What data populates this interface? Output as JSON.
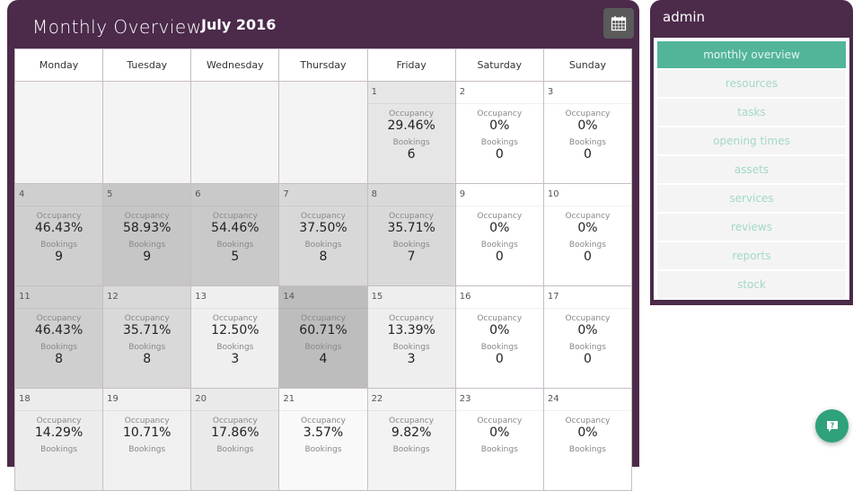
{
  "header": {
    "title": "Monthly Overview",
    "month": "July 2016",
    "calendar_icon": "calendar-icon"
  },
  "calendar": {
    "weekdays": [
      "Monday",
      "Tuesday",
      "Wednesday",
      "Thursday",
      "Friday",
      "Saturday",
      "Sunday"
    ],
    "occupancy_label": "Occupancy",
    "bookings_label": "Bookings",
    "weeks": [
      [
        null,
        null,
        null,
        null,
        {
          "day": "1",
          "occupancy": "29.46%",
          "bookings": "6",
          "bg": "#e6e6e6"
        },
        {
          "day": "2",
          "occupancy": "0%",
          "bookings": "0",
          "bg": "#ffffff"
        },
        {
          "day": "3",
          "occupancy": "0%",
          "bookings": "0",
          "bg": "#ffffff"
        }
      ],
      [
        {
          "day": "4",
          "occupancy": "46.43%",
          "bookings": "9",
          "bg": "#cfcfcf"
        },
        {
          "day": "5",
          "occupancy": "58.93%",
          "bookings": "9",
          "bg": "#c6c6c6"
        },
        {
          "day": "6",
          "occupancy": "54.46%",
          "bookings": "5",
          "bg": "#c9c9c9"
        },
        {
          "day": "7",
          "occupancy": "37.50%",
          "bookings": "8",
          "bg": "#d8d8d8"
        },
        {
          "day": "8",
          "occupancy": "35.71%",
          "bookings": "7",
          "bg": "#d9d9d9"
        },
        {
          "day": "9",
          "occupancy": "0%",
          "bookings": "0",
          "bg": "#ffffff"
        },
        {
          "day": "10",
          "occupancy": "0%",
          "bookings": "0",
          "bg": "#ffffff"
        }
      ],
      [
        {
          "day": "11",
          "occupancy": "46.43%",
          "bookings": "8",
          "bg": "#cfcfcf"
        },
        {
          "day": "12",
          "occupancy": "35.71%",
          "bookings": "8",
          "bg": "#d9d9d9"
        },
        {
          "day": "13",
          "occupancy": "12.50%",
          "bookings": "3",
          "bg": "#efefef"
        },
        {
          "day": "14",
          "occupancy": "60.71%",
          "bookings": "4",
          "bg": "#bdbdbd"
        },
        {
          "day": "15",
          "occupancy": "13.39%",
          "bookings": "3",
          "bg": "#eeeeee"
        },
        {
          "day": "16",
          "occupancy": "0%",
          "bookings": "0",
          "bg": "#ffffff"
        },
        {
          "day": "17",
          "occupancy": "0%",
          "bookings": "0",
          "bg": "#ffffff"
        }
      ],
      [
        {
          "day": "18",
          "occupancy": "14.29%",
          "bookings": "",
          "bg": "#ececec"
        },
        {
          "day": "19",
          "occupancy": "10.71%",
          "bookings": "",
          "bg": "#f0f0f0"
        },
        {
          "day": "20",
          "occupancy": "17.86%",
          "bookings": "",
          "bg": "#eaeaea"
        },
        {
          "day": "21",
          "occupancy": "3.57%",
          "bookings": "",
          "bg": "#f9f9f9"
        },
        {
          "day": "22",
          "occupancy": "9.82%",
          "bookings": "",
          "bg": "#f3f3f3"
        },
        {
          "day": "23",
          "occupancy": "0%",
          "bookings": "",
          "bg": "#ffffff"
        },
        {
          "day": "24",
          "occupancy": "0%",
          "bookings": "",
          "bg": "#ffffff"
        }
      ]
    ]
  },
  "sidebar": {
    "title": "admin",
    "items": [
      {
        "label": "monthly overview",
        "active": true
      },
      {
        "label": "resources"
      },
      {
        "label": "tasks"
      },
      {
        "label": "opening times"
      },
      {
        "label": "assets"
      },
      {
        "label": "services"
      },
      {
        "label": "reviews"
      },
      {
        "label": "reports"
      },
      {
        "label": "stock"
      }
    ]
  },
  "help": {
    "icon": "help-chat-icon"
  },
  "colors": {
    "brand": "#4b2a4a",
    "accent": "#52b59a",
    "help": "#2fa27b"
  }
}
